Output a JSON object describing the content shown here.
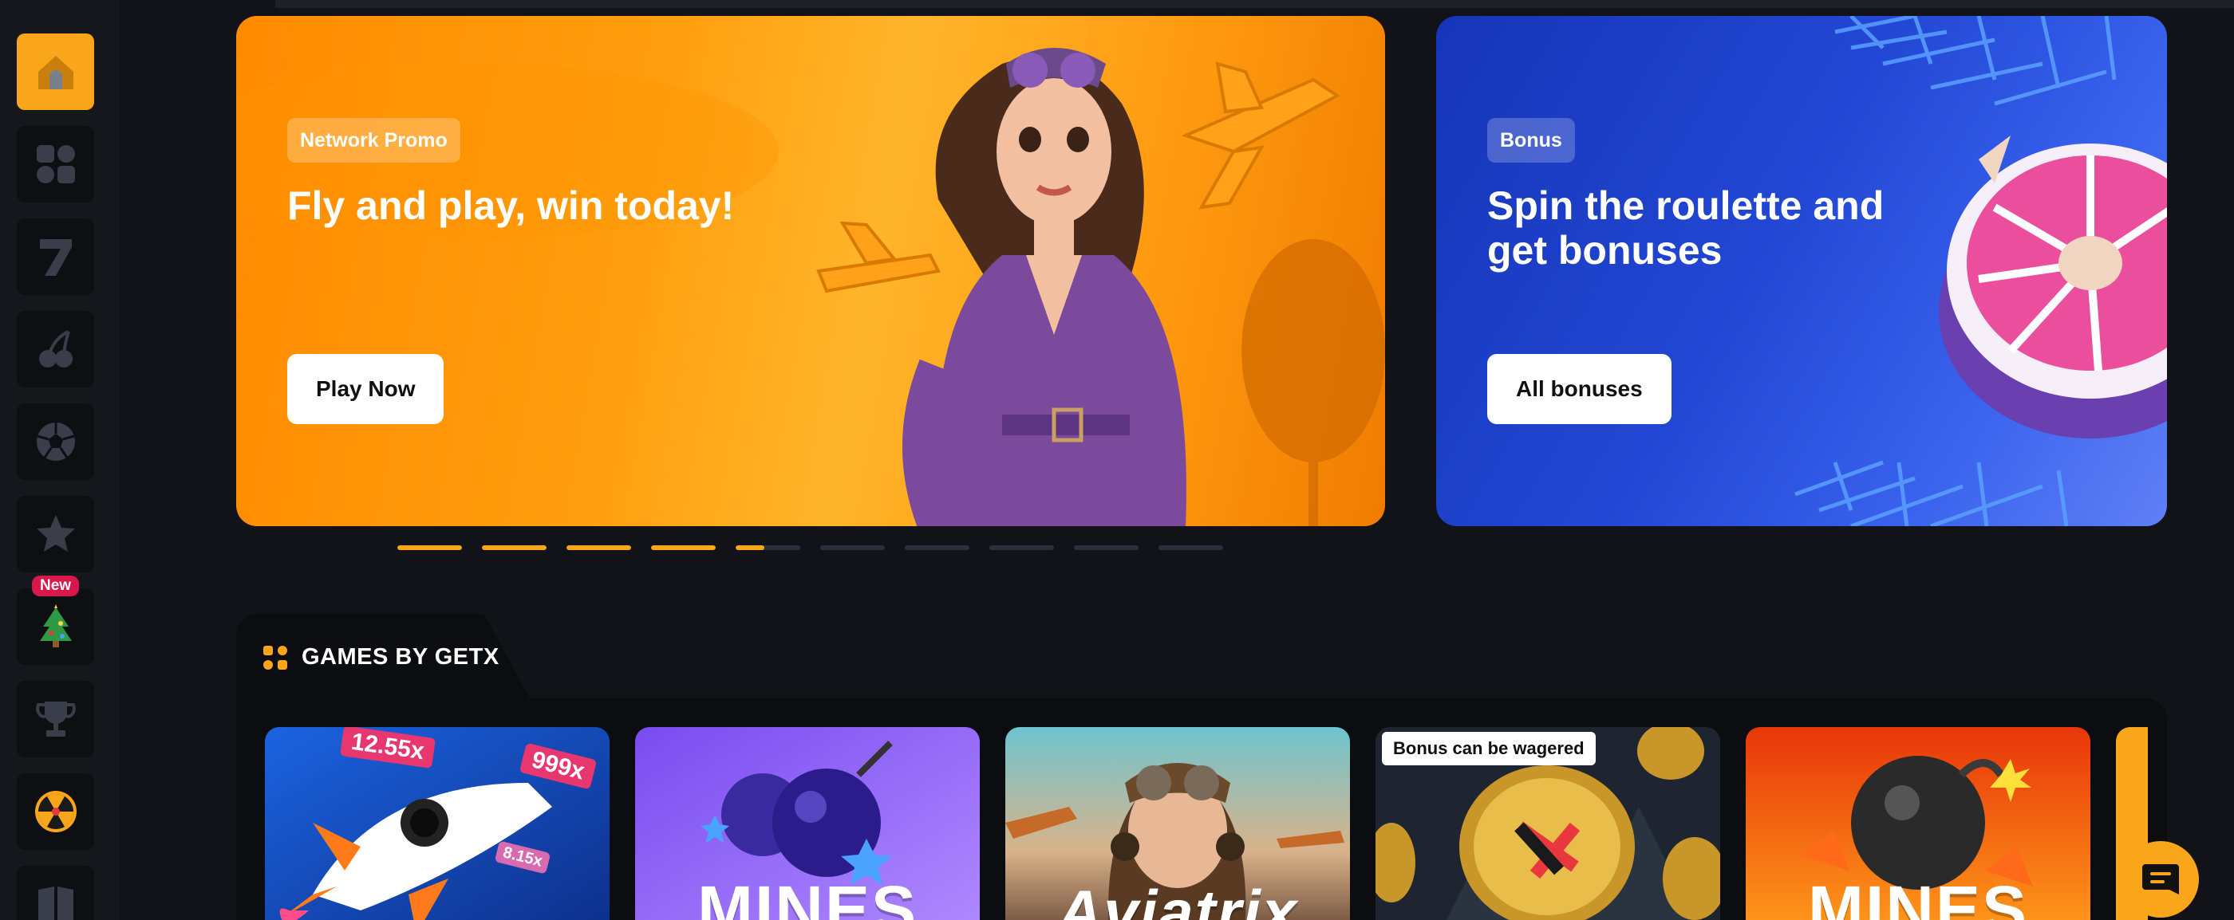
{
  "sidebar": {
    "items": [
      {
        "icon": "home-icon",
        "active": true
      },
      {
        "icon": "grid-icon"
      },
      {
        "icon": "seven-icon"
      },
      {
        "icon": "cherries-icon"
      },
      {
        "icon": "soccer-ball-icon"
      },
      {
        "icon": "star-icon"
      },
      {
        "icon": "christmas-tree-icon",
        "badge": "New"
      },
      {
        "icon": "trophy-icon"
      },
      {
        "icon": "radiation-wheel-icon"
      },
      {
        "icon": "book-icon"
      }
    ],
    "new_badge": "New"
  },
  "banners": [
    {
      "tag": "Network Promo",
      "title": "Fly and play, win today!",
      "cta": "Play Now"
    },
    {
      "tag": "Bonus",
      "title": "Spin the roulette and get bonuses",
      "cta": "All bonuses"
    }
  ],
  "carousel": {
    "total": 10,
    "current_index": 4,
    "current_progress": 0.45,
    "accent": "#f9a61a"
  },
  "games_section": {
    "title": "GAMES BY GETX",
    "cards": [
      {
        "name": "rocket-game",
        "multipliers": [
          "12.55x",
          "999x",
          "8.15x"
        ]
      },
      {
        "name": "mines-purple",
        "title": "MINES"
      },
      {
        "name": "aviatrix",
        "title": "Aviatrix"
      },
      {
        "name": "coin-game",
        "badge": "Bonus can be wagered"
      },
      {
        "name": "mines-orange",
        "title": "MINES"
      }
    ]
  },
  "colors": {
    "background": "#111318",
    "sidebar": "#15171d",
    "accent": "#f9a61a",
    "badge_red": "#d8174a"
  }
}
